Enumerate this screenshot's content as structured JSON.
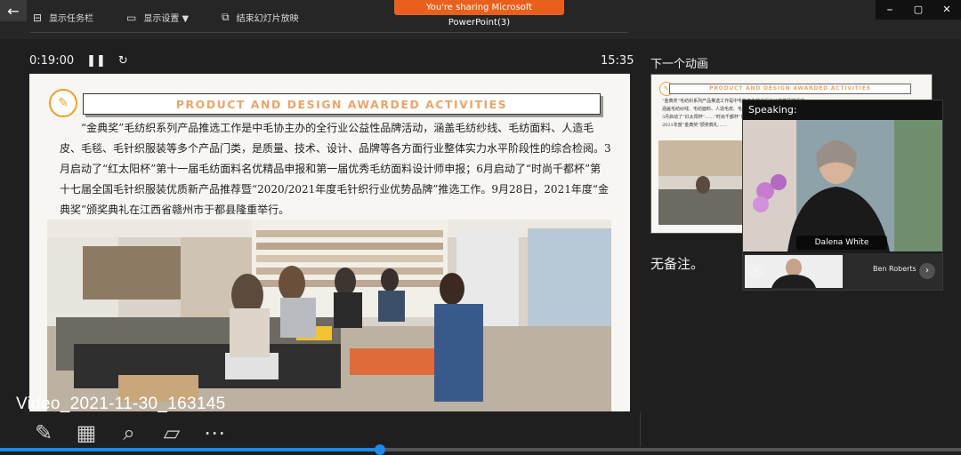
{
  "toolbar": {
    "back_icon": "arrow-left-icon",
    "show_taskbar": "显示任务栏",
    "display_settings": "显示设置 ▼",
    "end_slideshow": "结束幻灯片放映"
  },
  "share_banner": "You're sharing Microsoft PowerPoint(3)",
  "window_controls": [
    "⎯",
    "▢",
    "✕"
  ],
  "presenter": {
    "elapsed": "0:19:00",
    "clock": "15:35",
    "next_animation_label": "下一个动画",
    "no_notes": "无备注。"
  },
  "slide": {
    "title": "PRODUCT AND DESIGN AWARDED ACTIVITIES",
    "body": "“金典奖”毛纺织系列产品推选工作是中毛协主办的全行业公益性品牌活动，涵盖毛纺纱线、毛纺面料、人造毛皮、毛毯、毛针织服装等多个产品门类，是质量、技术、设计、品牌等各方面行业整体实力水平阶段性的综合检阅。3月启动了“红太阳杯”第十一届毛纺面料名优精品申报和第一届优秀毛纺面料设计师申报；6月启动了“时尚千都杯”第十七届全国毛针织服装优质新产品推荐暨“2020/2021年度毛针织行业优势品牌”推选工作。9月28日，2021年度“金典奖”颁奖典礼在江西省赣州市于都县隆重举行。"
  },
  "thumb": {
    "title": "PRODUCT AND DESIGN AWARDED ACTIVITIES",
    "body": "“金典奖”毛纺织系列产品推选工作是中毛协主办的全行业公益性品牌活动，涵盖毛纺纱线、毛纺面料、人造毛皮、毛毯、毛针织服装等多个产品门类……3月启动了“红太阳杯”……“时尚千都杯”第十七届全国毛针织……9月28日，2021年度“金典奖”颁奖典礼……"
  },
  "speaking": {
    "label": "Speaking:",
    "main_name": "Dalena White",
    "second_name": "Ben Roberts"
  },
  "video_label": "Video_2021-11-30_163145",
  "bottom_icons": [
    "pen-icon",
    "slides-grid-icon",
    "zoom-icon",
    "screen-off-icon",
    "more-options-icon"
  ],
  "playback": {
    "progress_fraction": 0.395
  },
  "colors": {
    "share_banner": "#e8601c",
    "accent_orange": "#e8a66b",
    "progress": "#1e88e5"
  }
}
